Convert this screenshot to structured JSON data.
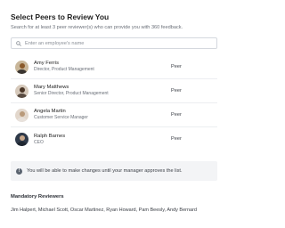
{
  "header": {
    "title": "Select Peers to Review You",
    "subtitle": "Search for at least 3 peer reviewer(s) who can provide you with 360 feedback."
  },
  "search": {
    "placeholder": "Enter an employee's name",
    "value": "",
    "icon": "search-icon"
  },
  "peers": [
    {
      "name": "Amy Ferris",
      "title": "Director, Product Management",
      "role": "Peer",
      "avatar_bg": "#c9b79a",
      "hair": "#8a5a2b",
      "shirt": "#3a3530"
    },
    {
      "name": "Mary Matthews",
      "title": "Senior Director, Product Management",
      "role": "Peer",
      "avatar_bg": "#d6c9bb",
      "hair": "#4a3526",
      "shirt": "#5a4c42"
    },
    {
      "name": "Angela Martin",
      "title": "Customer Service Manager",
      "role": "Peer",
      "avatar_bg": "#e2d7cc",
      "hair": "#b99a7a",
      "shirt": "#e8e2dc"
    },
    {
      "name": "Ralph Barnes",
      "title": "CEO",
      "role": "Peer",
      "avatar_bg": "#2f3a4a",
      "hair": "#1d1d1d",
      "shirt": "#1f2630"
    }
  ],
  "notice": {
    "icon": "info-icon",
    "text": "You will be able to make changes until your manager approves the list."
  },
  "mandatory": {
    "heading": "Mandatory Reviewers",
    "names": "Jim Halpert,  Michael Scott,  Oscar Martinez,  Ryan Howard,  Pam Beesly,  Andy Bernard"
  }
}
